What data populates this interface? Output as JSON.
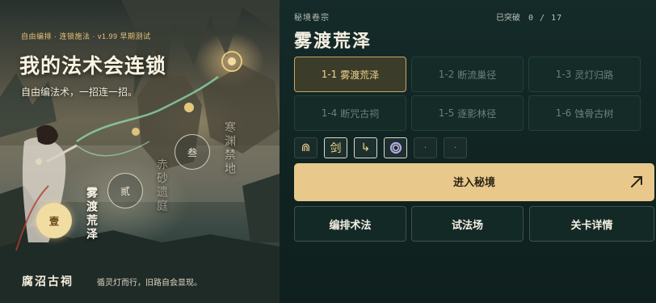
{
  "art": {
    "tagline": "自由编排 · 连锁施法 · v1.99 早期测试",
    "title": "我的法术会连锁",
    "subtitle": "自由编法术，一招连一招。",
    "nodes": [
      {
        "glyph": "壹",
        "name": "雾渡荒泽",
        "state": "current"
      },
      {
        "glyph": "贰",
        "name": "赤砂遗庭",
        "state": "locked"
      },
      {
        "glyph": "叁",
        "name": "寒渊禁地",
        "state": "locked"
      }
    ],
    "footer_title": "腐沼古祠",
    "footer_sub": "循灵灯而行，旧路自会显现。"
  },
  "panel": {
    "section_label": "秘境卷宗",
    "progress_label": "已突破",
    "progress_value": "0 / 17",
    "title": "雾渡荒泽",
    "stages": [
      {
        "code": "1-1",
        "name": "雾渡荒泽",
        "state": "active"
      },
      {
        "code": "1-2",
        "name": "断流巢径",
        "state": "locked"
      },
      {
        "code": "1-3",
        "name": "灵灯归路",
        "state": "locked"
      },
      {
        "code": "1-4",
        "name": "断咒古祠",
        "state": "locked"
      },
      {
        "code": "1-5",
        "name": "逐影林径",
        "state": "locked"
      },
      {
        "code": "1-6",
        "name": "蚀骨古树",
        "state": "locked"
      }
    ],
    "runes": [
      {
        "icon": "fork-rune-icon",
        "glyph": "⋒"
      },
      {
        "icon": "sword-rune-icon",
        "glyph": "剑"
      },
      {
        "icon": "redirect-arrow-rune-icon",
        "glyph": "↳"
      },
      {
        "icon": "ring-rune-icon",
        "glyph": ""
      },
      {
        "icon": "empty-slot-icon",
        "glyph": "·"
      },
      {
        "icon": "empty-slot-icon",
        "glyph": "·"
      }
    ],
    "enter_label": "进入秘境",
    "buttons": {
      "arrange": "编排术法",
      "trial": "试法场",
      "details": "关卡详情"
    }
  },
  "colors": {
    "accent_gold": "#e9c88c",
    "panel_bg": "#102321",
    "active_border": "#c8a566"
  }
}
